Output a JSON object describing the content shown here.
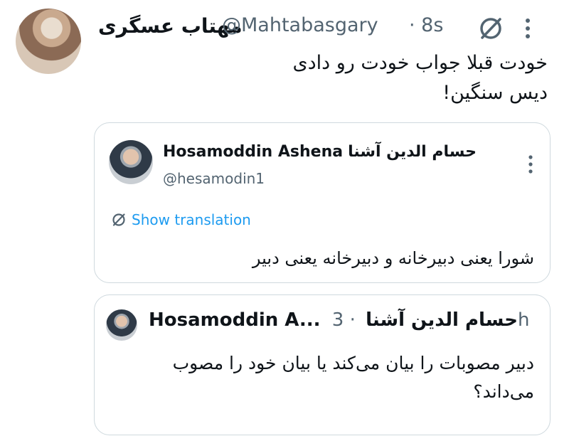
{
  "tweet": {
    "author_name": "مهتاب عسگری",
    "handle": "@Mahtabasgary",
    "time": "· 8s",
    "text_line1": "خودت قبلا جواب خودت رو دادی",
    "text_line2": "دیس سنگین!",
    "icons": {
      "grok": "grok-icon",
      "more": "more-vertical-icon"
    }
  },
  "quote1": {
    "name_fa": "حسام الدین آشنا",
    "name_en": "Hosamoddin Ashena",
    "handle": "@hesamodin1",
    "translation_label": "Show translation",
    "text": "شورا یعنی دبیرخانه و دبیرخانه یعنی دبیر"
  },
  "quote2": {
    "name_en": "Hosamoddin A...",
    "name_fa": "حسام الدین آشنا",
    "time": "· 3h",
    "text": "دبیر مصوبات را بیان می‌کند یا بیان خود را مصوب می‌داند؟"
  },
  "colors": {
    "accent": "#1d9bf0",
    "muted": "#536471",
    "border": "#cfd9de"
  }
}
